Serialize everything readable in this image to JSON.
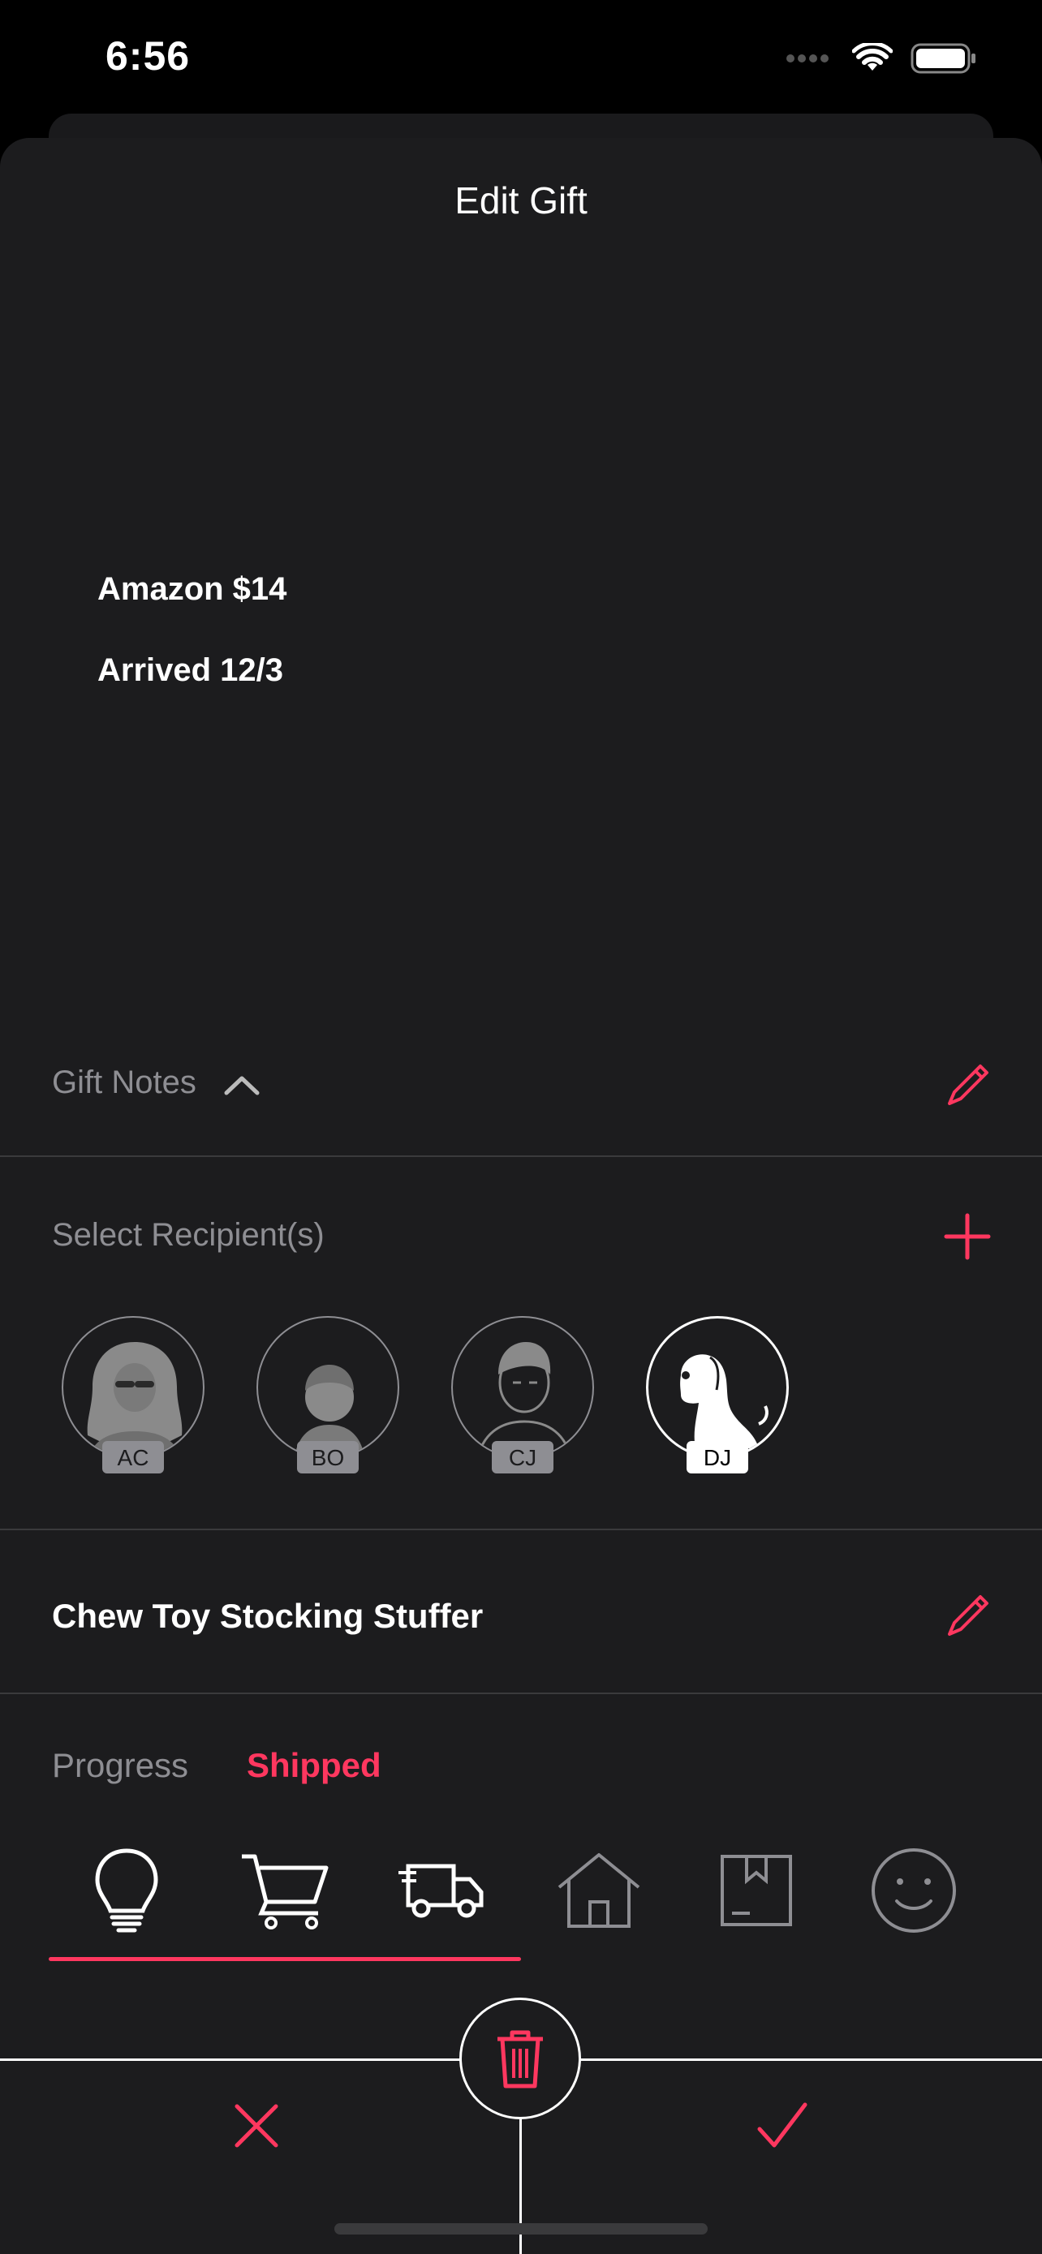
{
  "status_bar": {
    "time": "6:56"
  },
  "header": {
    "title": "Edit Gift"
  },
  "notes": {
    "lines": [
      "Amazon $14",
      "Arrived 12/3"
    ],
    "label": "Gift Notes"
  },
  "recipients": {
    "label": "Select Recipient(s)",
    "people": [
      {
        "initials": "AC",
        "selected": false
      },
      {
        "initials": "BO",
        "selected": false
      },
      {
        "initials": "CJ",
        "selected": false
      },
      {
        "initials": "DJ",
        "selected": true
      }
    ]
  },
  "gift": {
    "name": "Chew Toy Stocking Stuffer"
  },
  "progress": {
    "label": "Progress",
    "status": "Shipped",
    "stages": [
      "lightbulb-icon",
      "cart-icon",
      "truck-icon",
      "house-icon",
      "box-icon",
      "smiley-icon"
    ],
    "completed_fraction": 0.5
  },
  "colors": {
    "accent": "#ff375f",
    "background": "#1c1c1e",
    "muted": "#8e8e93"
  }
}
